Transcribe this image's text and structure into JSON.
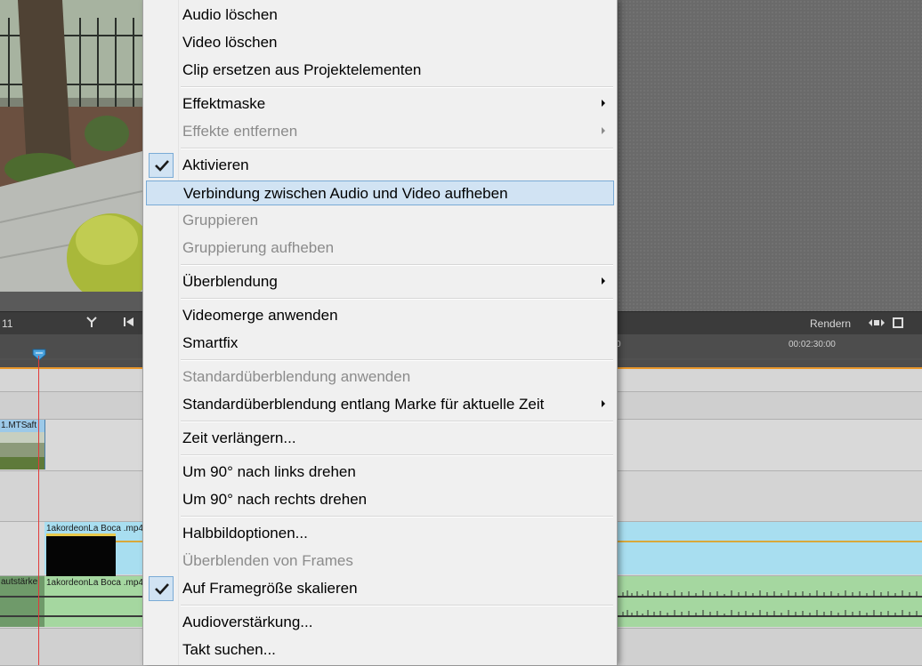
{
  "toolbar": {
    "left_text": "11",
    "render_label": "Rendern"
  },
  "ruler": {
    "partial_tick": "0",
    "timecode": "00:02:30:00"
  },
  "clips": {
    "video_top_label": "1.MTS",
    "video_top_suffix": "aft",
    "video_blue_label": "1akordeonLa Boca .mp4",
    "audio_left_label": "autstärke",
    "audio_green_label": "1akordeonLa Boca .mp4"
  },
  "menu": {
    "items": [
      {
        "label": "Audio löschen",
        "enabled": true
      },
      {
        "label": "Video löschen",
        "enabled": true
      },
      {
        "label": "Clip ersetzen aus Projektelementen",
        "enabled": true
      },
      {
        "label": "Effektmaske",
        "enabled": true,
        "submenu": true
      },
      {
        "label": "Effekte entfernen",
        "enabled": false,
        "submenu": true
      },
      {
        "label": "Aktivieren",
        "enabled": true,
        "checked": true
      },
      {
        "label": "Verbindung zwischen Audio und Video aufheben",
        "enabled": true,
        "highlighted": true
      },
      {
        "label": "Gruppieren",
        "enabled": false
      },
      {
        "label": "Gruppierung aufheben",
        "enabled": false
      },
      {
        "label": "Überblendung",
        "enabled": true,
        "submenu": true
      },
      {
        "label": "Videomerge anwenden",
        "enabled": true
      },
      {
        "label": "Smartfix",
        "enabled": true
      },
      {
        "label": "Standardüberblendung anwenden",
        "enabled": false
      },
      {
        "label": "Standardüberblendung entlang Marke für aktuelle Zeit",
        "enabled": true,
        "submenu": true
      },
      {
        "label": "Zeit verlängern...",
        "enabled": true
      },
      {
        "label": "Um 90° nach links drehen",
        "enabled": true
      },
      {
        "label": "Um 90° nach rechts drehen",
        "enabled": true
      },
      {
        "label": "Halbbildoptionen...",
        "enabled": true
      },
      {
        "label": "Überblenden von Frames",
        "enabled": false
      },
      {
        "label": "Auf Framegröße skalieren",
        "enabled": true,
        "checked": true
      },
      {
        "label": "Audioverstärkung...",
        "enabled": true
      },
      {
        "label": "Takt suchen...",
        "enabled": true
      }
    ]
  }
}
